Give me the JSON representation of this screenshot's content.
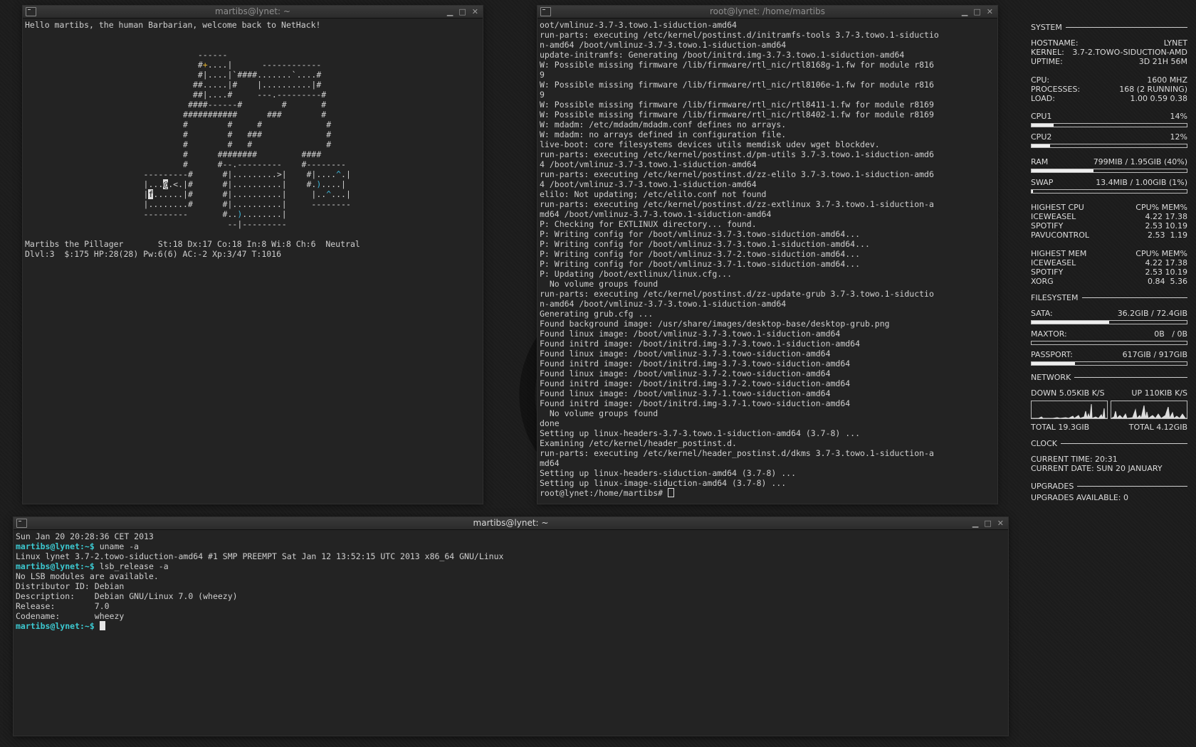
{
  "nethack_window": {
    "title": "martibs@lynet: ~",
    "lines": [
      "Hello martibs, the human Barbarian, welcome back to NetHack!",
      "",
      "",
      "                                   ------",
      "                                   #+....|      ------------",
      "                                   #|....|`####.......`....#",
      "                                  ##.....|#    |..........|#",
      "                                  ##|....#     ---.---------#",
      "                                 ####------#        #       #",
      "                                ###########      ###        #",
      "                                #        #     #             #",
      "                                #        #   ###             #",
      "                                #        #   #               #",
      "                                #      ########         ####",
      "                                #      #--.---------    #--------",
      "                        ---------#      #|.........>|    #|....^.|",
      "                        |...@.<.|#      #|..........|    #.)....|",
      "                        |f......|#      #|..........|     |..^...|",
      "                        |........#      #|..........|     --------",
      "                        ---------       #..)........|",
      "                                         --|---------",
      "",
      "Martibs the Pillager       St:18 Dx:17 Co:18 In:8 Wi:8 Ch:6  Neutral",
      "Dlvl:3  $:175 HP:28(28) Pw:6(6) AC:-2 Xp:3/47 T:1016"
    ]
  },
  "root_window": {
    "title": "root@lynet: /home/martibs",
    "lines": [
      "oot/vmlinuz-3.7-3.towo.1-siduction-amd64",
      "run-parts: executing /etc/kernel/postinst.d/initramfs-tools 3.7-3.towo.1-siductio",
      "n-amd64 /boot/vmlinuz-3.7-3.towo.1-siduction-amd64",
      "update-initramfs: Generating /boot/initrd.img-3.7-3.towo.1-siduction-amd64",
      "W: Possible missing firmware /lib/firmware/rtl_nic/rtl8168g-1.fw for module r816",
      "9",
      "W: Possible missing firmware /lib/firmware/rtl_nic/rtl8106e-1.fw for module r816",
      "9",
      "W: Possible missing firmware /lib/firmware/rtl_nic/rtl8411-1.fw for module r8169",
      "W: Possible missing firmware /lib/firmware/rtl_nic/rtl8402-1.fw for module r8169",
      "W: mdadm: /etc/mdadm/mdadm.conf defines no arrays.",
      "W: mdadm: no arrays defined in configuration file.",
      "live-boot: core filesystems devices utils memdisk udev wget blockdev.",
      "run-parts: executing /etc/kernel/postinst.d/pm-utils 3.7-3.towo.1-siduction-amd6",
      "4 /boot/vmlinuz-3.7-3.towo.1-siduction-amd64",
      "run-parts: executing /etc/kernel/postinst.d/zz-elilo 3.7-3.towo.1-siduction-amd6",
      "4 /boot/vmlinuz-3.7-3.towo.1-siduction-amd64",
      "elilo: Not updating; /etc/elilo.conf not found",
      "run-parts: executing /etc/kernel/postinst.d/zz-extlinux 3.7-3.towo.1-siduction-a",
      "md64 /boot/vmlinuz-3.7-3.towo.1-siduction-amd64",
      "P: Checking for EXTLINUX directory... found.",
      "P: Writing config for /boot/vmlinuz-3.7-3.towo-siduction-amd64...",
      "P: Writing config for /boot/vmlinuz-3.7-3.towo.1-siduction-amd64...",
      "P: Writing config for /boot/vmlinuz-3.7-2.towo-siduction-amd64...",
      "P: Writing config for /boot/vmlinuz-3.7-1.towo-siduction-amd64...",
      "P: Updating /boot/extlinux/linux.cfg...",
      "  No volume groups found",
      "run-parts: executing /etc/kernel/postinst.d/zz-update-grub 3.7-3.towo.1-siductio",
      "n-amd64 /boot/vmlinuz-3.7-3.towo.1-siduction-amd64",
      "Generating grub.cfg ...",
      "Found background image: /usr/share/images/desktop-base/desktop-grub.png",
      "Found linux image: /boot/vmlinuz-3.7-3.towo.1-siduction-amd64",
      "Found initrd image: /boot/initrd.img-3.7-3.towo.1-siduction-amd64",
      "Found linux image: /boot/vmlinuz-3.7-3.towo-siduction-amd64",
      "Found initrd image: /boot/initrd.img-3.7-3.towo-siduction-amd64",
      "Found linux image: /boot/vmlinuz-3.7-2.towo-siduction-amd64",
      "Found initrd image: /boot/initrd.img-3.7-2.towo-siduction-amd64",
      "Found linux image: /boot/vmlinuz-3.7-1.towo-siduction-amd64",
      "Found initrd image: /boot/initrd.img-3.7-1.towo-siduction-amd64",
      "  No volume groups found",
      "done",
      "Setting up linux-headers-3.7-3.towo.1-siduction-amd64 (3.7-8) ...",
      "Examining /etc/kernel/header_postinst.d.",
      "run-parts: executing /etc/kernel/header_postinst.d/dkms 3.7-3.towo.1-siduction-a",
      "md64",
      "Setting up linux-headers-siduction-amd64 (3.7-8) ...",
      "Setting up linux-image-siduction-amd64 (3.7-8) ..."
    ],
    "prompt": "root@lynet:/home/martibs# "
  },
  "bottom_window": {
    "title": "martibs@lynet: ~",
    "date_line": "Sun Jan 20 20:28:36 CET 2013",
    "prompt": "martibs@lynet:~$",
    "cmd1": " uname -a",
    "out1": "Linux lynet 3.7-2.towo-siduction-amd64 #1 SMP PREEMPT Sat Jan 12 13:52:15 UTC 2013 x86_64 GNU/Linux",
    "cmd2": " lsb_release -a",
    "out2": [
      "No LSB modules are available.",
      "Distributor ID: Debian",
      "Description:    Debian GNU/Linux 7.0 (wheezy)",
      "Release:        7.0",
      "Codename:       wheezy"
    ]
  },
  "window_controls": {
    "minimize": "▁",
    "maximize": "□",
    "close": "✕"
  },
  "conky": {
    "system_head": "SYSTEM",
    "hostname_label": "HOSTNAME:",
    "hostname": "LYNET",
    "kernel_label": "KERNEL:",
    "kernel": "3.7-2.TOWO-SIDUCTION-AMD",
    "uptime_label": "UPTIME:",
    "uptime": "3D 21H 56M",
    "cpu_label": "CPU:",
    "cpu": "1600 MHZ",
    "processes_label": "PROCESSES:",
    "processes": "168 (2 RUNNING)",
    "load_label": "LOAD:",
    "load": "1.00 0.59 0.38",
    "cpu1_label": "CPU1",
    "cpu1": "14%",
    "cpu1_pct": 14,
    "cpu2_label": "CPU2",
    "cpu2": "12%",
    "cpu2_pct": 12,
    "ram_label": "RAM",
    "ram": "799MIB / 1.95GIB (40%)",
    "ram_pct": 40,
    "swap_label": "SWAP",
    "swap": "13.4MIB / 1.00GIB (1%)",
    "swap_pct": 1,
    "highest_cpu_label": "HIGHEST CPU",
    "highest_cpu_cols": "CPU% MEM%",
    "highest_cpu": [
      {
        "name": "ICEWEASEL",
        "vals": "4.22 17.38"
      },
      {
        "name": "SPOTIFY",
        "vals": "2.53 10.19"
      },
      {
        "name": "PAVUCONTROL",
        "vals": "2.53  1.19"
      }
    ],
    "highest_mem_label": "HIGHEST MEM",
    "highest_mem_cols": "CPU% MEM%",
    "highest_mem": [
      {
        "name": "ICEWEASEL",
        "vals": "4.22 17.38"
      },
      {
        "name": "SPOTIFY",
        "vals": "2.53 10.19"
      },
      {
        "name": "XORG",
        "vals": "0.84  5.36"
      }
    ],
    "filesystem_head": "FILESYSTEM",
    "sata_label": "SATA:",
    "sata": "36.2GIB / 72.4GIB",
    "sata_pct": 50,
    "maxtor_label": "MAXTOR:",
    "maxtor": "0B   / 0B",
    "maxtor_pct": 0,
    "passport_label": "PASSPORT:",
    "passport": "617GIB / 917GIB",
    "passport_pct": 28,
    "network_head": "NETWORK",
    "down": "DOWN 5.05KIB K/S",
    "up": "UP 110KIB K/S",
    "total_down": "TOTAL 19.3GIB",
    "total_up": "TOTAL 4.12GIB",
    "clock_head": "CLOCK",
    "time_label": "CURRENT TIME:",
    "time": "20:31",
    "date_label": "CURRENT DATE:",
    "date": "SUN 20 JANUARY",
    "upgrades_head": "UPGRADES",
    "upgrades_label": "UPGRADES AVAILABLE:",
    "upgrades": "0"
  }
}
